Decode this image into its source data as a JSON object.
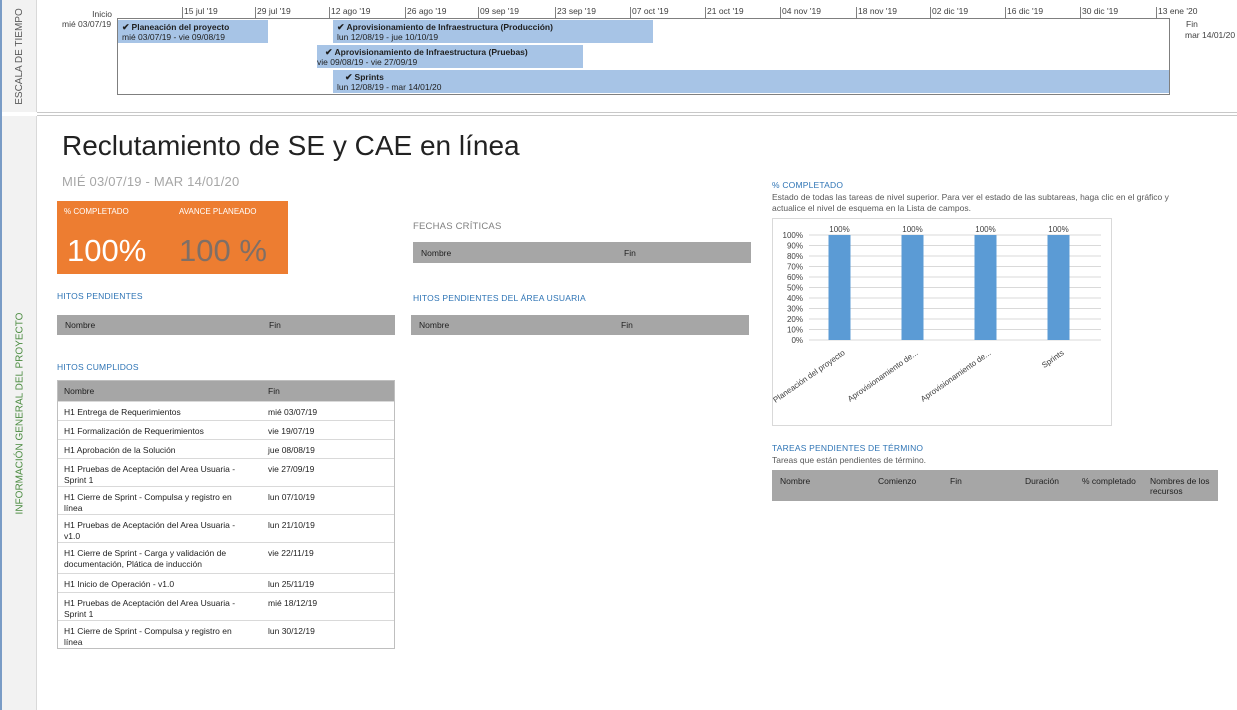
{
  "timeline": {
    "side_label": "ESCALA DE TIEMPO",
    "start_label": "Inicio",
    "start_date": "mié 03/07/19",
    "end_label": "Fin",
    "end_date": "mar 14/01/20",
    "dates": [
      "15 jul '19",
      "29 jul '19",
      "12 ago '19",
      "26 ago '19",
      "09 sep '19",
      "23 sep '19",
      "07 oct '19",
      "21 oct '19",
      "04 nov '19",
      "18 nov '19",
      "02 dic '19",
      "16 dic '19",
      "30 dic '19",
      "13 ene '20"
    ],
    "bars": [
      {
        "name": "Planeación del proyecto",
        "range": "mié 03/07/19 - vie 09/08/19"
      },
      {
        "name": "Aprovisionamiento de Infraestructura (Producción)",
        "range": "lun 12/08/19 - jue 10/10/19"
      },
      {
        "name": "Aprovisionamiento de Infraestructura (Pruebas)",
        "range": "vie 09/08/19 - vie 27/09/19"
      },
      {
        "name": "Sprints",
        "range": "lun 12/08/19 - mar 14/01/20"
      }
    ],
    "check_icon": "✔"
  },
  "report": {
    "side_label": "INFORMACIÓN GENERAL DEL PROYECTO",
    "title": "Reclutamiento de SE y CAE en línea",
    "subtitle": "MIÉ 03/07/19 -  MAR 14/01/20",
    "kpi": {
      "completed_label": "% COMPLETADO",
      "completed_value": "100%",
      "planned_label": "AVANCE PLANEADO",
      "planned_value": "100 %"
    },
    "hitos_pendientes": {
      "title": "HITOS PENDIENTES",
      "col1": "Nombre",
      "col2": "Fin"
    },
    "fechas_criticas": {
      "title": "FECHAS CRÍTICAS",
      "col1": "Nombre",
      "col2": "Fin"
    },
    "hitos_area_usuaria": {
      "title": "HITOS PENDIENTES DEL ÁREA USUARIA",
      "col1": "Nombre",
      "col2": "Fin"
    },
    "hitos_cumplidos": {
      "title": "HITOS CUMPLIDOS",
      "col1": "Nombre",
      "col2": "Fin",
      "rows": [
        {
          "name": "H1 Entrega de Requerimientos",
          "end": "mié 03/07/19"
        },
        {
          "name": "H1 Formalización de Requerimientos",
          "end": "vie 19/07/19"
        },
        {
          "name": "H1 Aprobación de la Solución",
          "end": "jue 08/08/19"
        },
        {
          "name": "H1 Pruebas de Aceptación del Area Usuaria - Sprint 1",
          "end": "vie 27/09/19"
        },
        {
          "name": "H1 Cierre de Sprint - Compulsa y registro en línea",
          "end": "lun 07/10/19"
        },
        {
          "name": "H1 Pruebas de Aceptación del Area Usuaria - v1.0",
          "end": "lun 21/10/19"
        },
        {
          "name": "H1 Cierre de Sprint - Carga y validación de documentación, Plática de inducción",
          "end": "vie 22/11/19"
        },
        {
          "name": "H1 Inicio de Operación - v1.0",
          "end": "lun 25/11/19"
        },
        {
          "name": "H1 Pruebas de Aceptación del Area Usuaria - Sprint 1",
          "end": "mié 18/12/19"
        },
        {
          "name": "H1 Cierre de Sprint - Compulsa y registro en línea",
          "end": "lun 30/12/19"
        }
      ]
    },
    "completado_chart": {
      "title": "% COMPLETADO",
      "description": "Estado de todas las tareas de nivel superior. Para ver el estado de las subtareas, haga clic en el gráfico y actualice el nivel de esquema en la Lista de campos."
    },
    "tareas_pendientes": {
      "title": "TAREAS PENDIENTES DE TÉRMINO",
      "description": "Tareas que están pendientes de término.",
      "columns": [
        "Nombre",
        "Comienzo",
        "Fin",
        "Duración",
        "% completado",
        "Nombres de los recursos"
      ]
    }
  },
  "chart_data": {
    "type": "bar",
    "categories": [
      "Planeación del proyecto",
      "Aprovisionamiento de...",
      "Aprovisionamiento de...",
      "Sprints"
    ],
    "values": [
      100,
      100,
      100,
      100
    ],
    "data_labels": [
      "100%",
      "100%",
      "100%",
      "100%"
    ],
    "y_ticks": [
      "0%",
      "10%",
      "20%",
      "30%",
      "40%",
      "50%",
      "60%",
      "70%",
      "80%",
      "90%",
      "100%"
    ],
    "ylim": [
      0,
      100
    ],
    "grid": true,
    "bar_color": "#5b9bd5"
  },
  "colors": {
    "accent_orange": "#ed7d31",
    "section_blue": "#2e74b5",
    "timeline_bar": "#a7c4e6",
    "header_gray": "#a6a6a6",
    "side_green": "#4a8b3f"
  }
}
